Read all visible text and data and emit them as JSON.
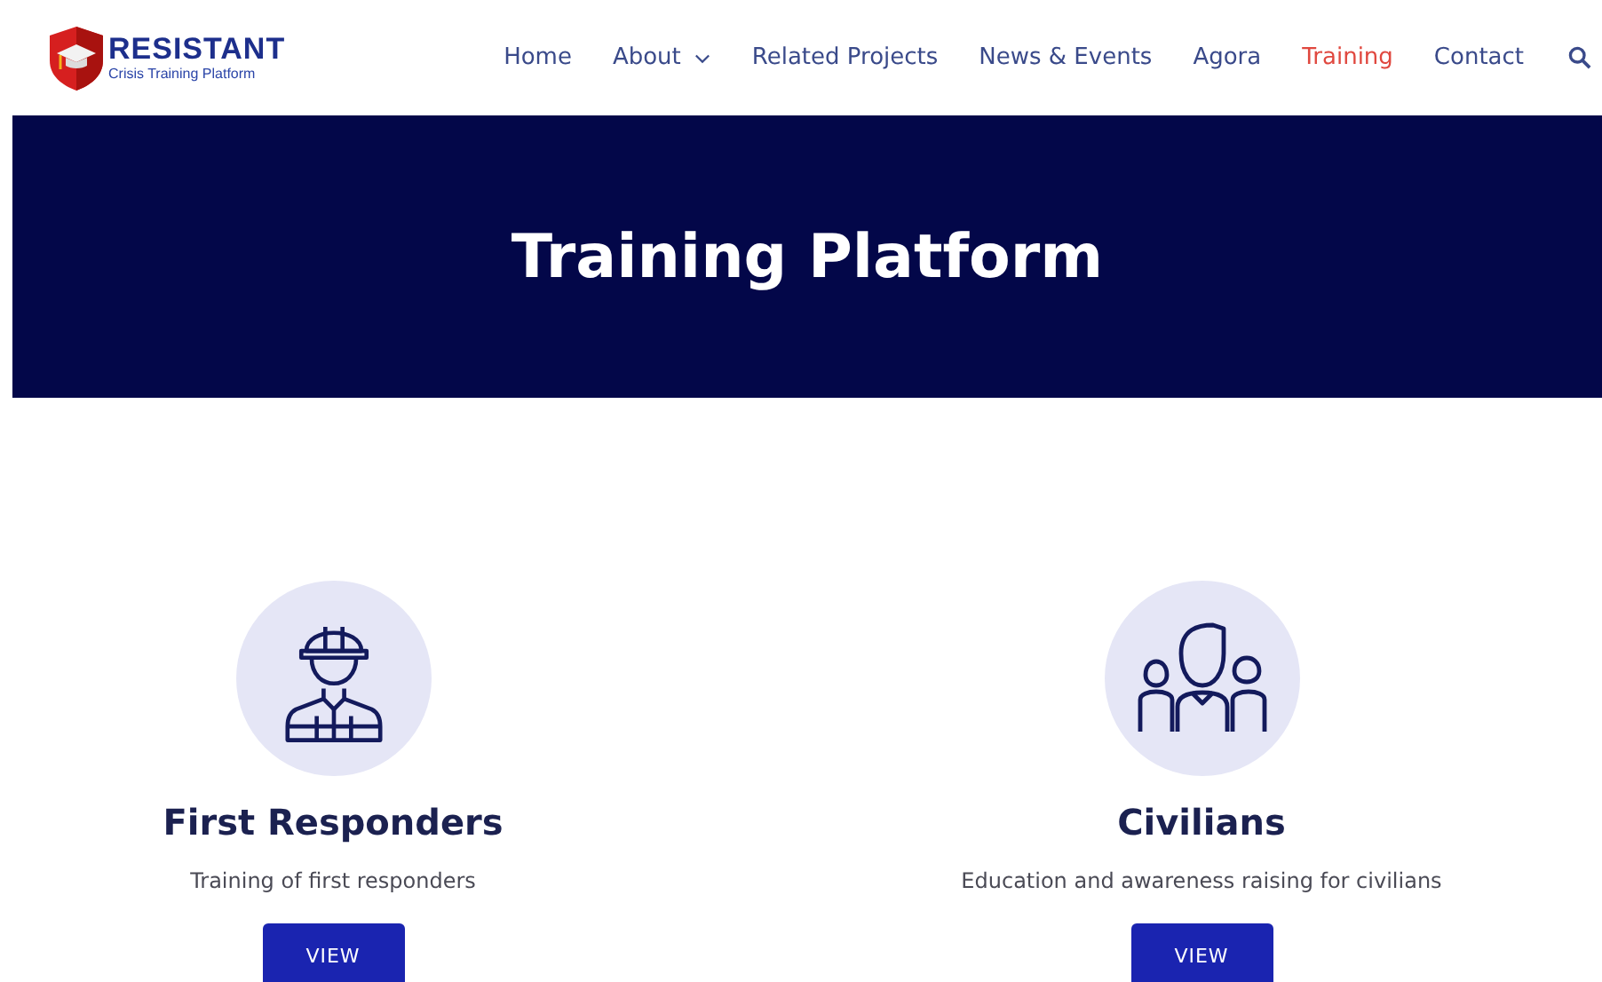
{
  "logo": {
    "name": "RESISTANT",
    "tagline": "Crisis Training Platform"
  },
  "nav": [
    {
      "label": "Home",
      "selected": false,
      "dropdown": false
    },
    {
      "label": "About",
      "selected": false,
      "dropdown": true
    },
    {
      "label": "Related Projects",
      "selected": false,
      "dropdown": false
    },
    {
      "label": "News & Events",
      "selected": false,
      "dropdown": false
    },
    {
      "label": "Agora",
      "selected": false,
      "dropdown": false
    },
    {
      "label": "Training",
      "selected": true,
      "dropdown": false
    },
    {
      "label": "Contact",
      "selected": false,
      "dropdown": false
    }
  ],
  "banner": {
    "title": "Training Platform"
  },
  "cards": [
    {
      "kind": "worker",
      "title": "First Responders",
      "text": "Training of first responders",
      "button": "VIEW"
    },
    {
      "kind": "group",
      "title": "Civilians",
      "text": "Education and awareness raising for civilians",
      "button": "VIEW"
    }
  ]
}
